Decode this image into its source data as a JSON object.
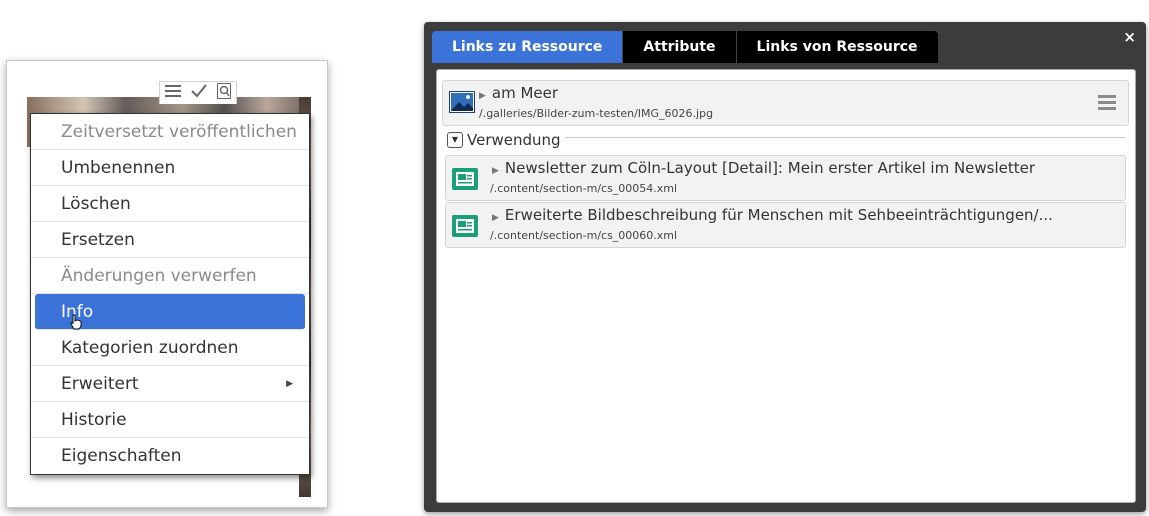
{
  "context_menu": {
    "items": [
      {
        "label": "Zeitversetzt veröffentlichen",
        "state": "disabled"
      },
      {
        "label": "Umbenennen",
        "state": "normal"
      },
      {
        "label": "Löschen",
        "state": "normal"
      },
      {
        "label": "Ersetzen",
        "state": "normal"
      },
      {
        "label": "Änderungen verwerfen",
        "state": "disabled"
      },
      {
        "label": "Info",
        "state": "active"
      },
      {
        "label": "Kategorien zuordnen",
        "state": "normal"
      },
      {
        "label": "Erweitert",
        "state": "submenu"
      },
      {
        "label": "Historie",
        "state": "normal"
      },
      {
        "label": "Eigenschaften",
        "state": "normal"
      }
    ],
    "toolbar_icons": [
      "menu-lines-icon",
      "checkmark-icon",
      "search-page-icon"
    ]
  },
  "dialog": {
    "tabs": [
      {
        "label": "Links zu Ressource",
        "active": true
      },
      {
        "label": "Attribute",
        "active": false
      },
      {
        "label": "Links von Ressource",
        "active": false
      }
    ],
    "close_label": "×",
    "resource": {
      "title": "am Meer",
      "path": "/.galleries/Bilder-zum-testen/IMG_6026.jpg"
    },
    "section_label": "Verwendung",
    "usages": [
      {
        "title": "Newsletter zum Cöln-Layout [Detail]: Mein erster Artikel im Newsletter",
        "path": "/.content/section-m/cs_00054.xml"
      },
      {
        "title": "Erweiterte Bildbeschreibung für Menschen mit Sehbeeinträchtigungen/...",
        "path": "/.content/section-m/cs_00060.xml"
      }
    ]
  },
  "colors": {
    "accent": "#3c73d8",
    "dialog_bg": "#3c3c3c",
    "tab_bg": "#000000"
  }
}
